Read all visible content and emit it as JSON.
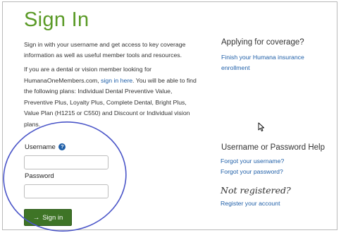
{
  "page": {
    "title": "Sign In",
    "intro_text": "Sign in with your username and get access to key coverage information as well as useful member tools and resources.",
    "dental_text_before": "If you are a dental or vision member looking for HumanaOneMembers.com, ",
    "dental_link": "sign in here",
    "dental_text_after": ". You will be able to find the following plans: Individual Dental Preventive Value, Preventive Plus, Loyalty Plus, Complete Dental, Bright Plus, Value Plan (H1215 or C550) and Discount or Individual vision plans."
  },
  "login_form": {
    "username_label": "Username",
    "help_icon_glyph": "?",
    "username_value": "",
    "password_label": "Password",
    "password_value": "",
    "signin_arrow": "→",
    "signin_label": "Sign in"
  },
  "sidebar": {
    "apply_heading": "Applying for coverage?",
    "apply_link": "Finish your Humana insurance enrollment",
    "help_heading": "Username or Password Help",
    "forgot_username": "Forgot your username?",
    "forgot_password": "Forgot your password?",
    "not_registered": "Not registered?",
    "register_link": "Register your account"
  },
  "colors": {
    "title_green": "#5a9a26",
    "button_green": "#3e7426",
    "link_blue": "#1f5fa8",
    "annotation_blue": "#4a55c8"
  },
  "icons": {
    "help": "help-circle-icon",
    "arrow": "arrow-right-icon",
    "cursor": "mouse-pointer-icon"
  }
}
